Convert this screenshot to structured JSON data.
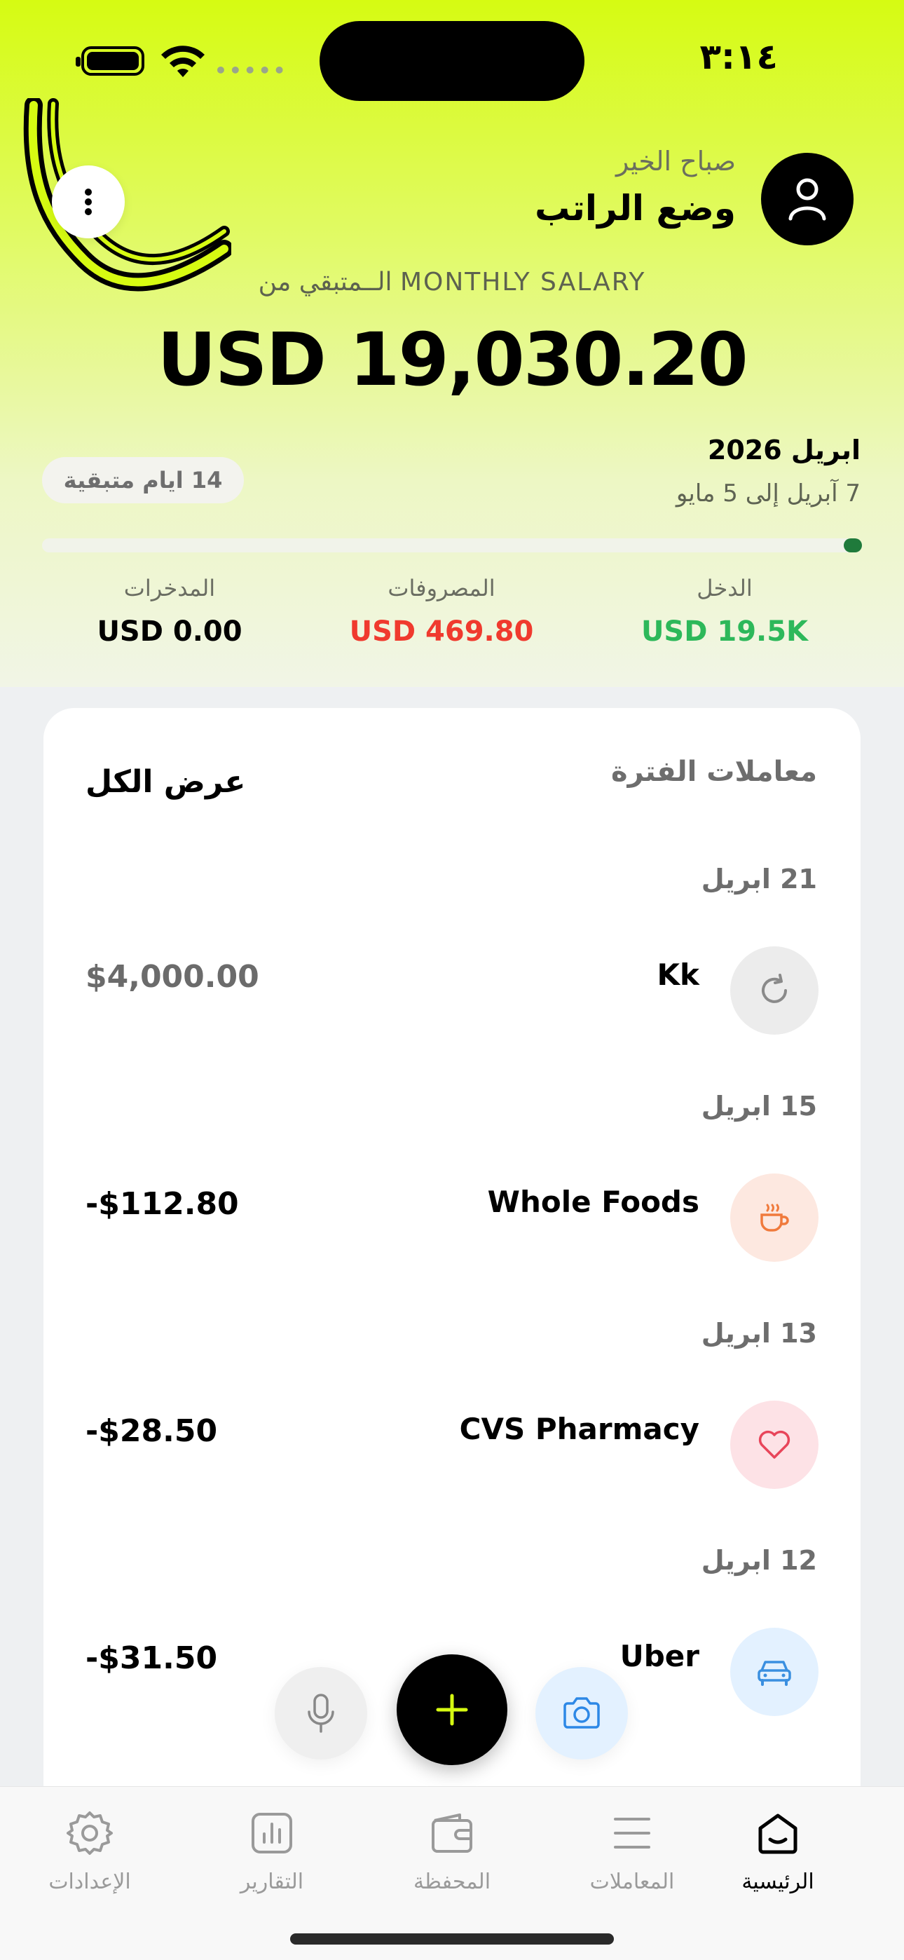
{
  "status_bar": {
    "time": "٣:١٤",
    "signal_dots": "•••••"
  },
  "header": {
    "greeting": "صباح الخير",
    "mode_title": "وضع الراتب",
    "remaining_label": "الــمتبقي من MONTHLY SALARY",
    "balance": "USD 19,030.20"
  },
  "period": {
    "month": "ابريل 2026",
    "range": "7 آبريل إلى 5 مايو",
    "days_left": "14 ايام متبقية",
    "progress_fraction": 0.01
  },
  "stats": {
    "income": {
      "label": "الدخل",
      "value": "USD 19.5K",
      "color": "#2db85a"
    },
    "expenses": {
      "label": "المصروفات",
      "value": "USD 469.80",
      "color": "#f03a2e"
    },
    "savings": {
      "label": "المدخرات",
      "value": "USD 0.00",
      "color": "#000000"
    }
  },
  "transactions_card": {
    "title": "معاملات الفترة",
    "view_all": "عرض الكل",
    "groups": [
      {
        "date": "21 ابريل",
        "name": "Kk",
        "amount": "$4,000.00",
        "icon": "refresh-icon",
        "amount_color": "#6b6b6b"
      },
      {
        "date": "15 ابريل",
        "name": "Whole Foods",
        "amount": "-$112.80",
        "icon": "coffee-cup-icon",
        "amount_color": "#000000"
      },
      {
        "date": "13 ابريل",
        "name": "CVS Pharmacy",
        "amount": "-$28.50",
        "icon": "heart-icon",
        "amount_color": "#000000"
      },
      {
        "date": "12 ابريل",
        "name": "Uber",
        "amount": "-$31.50",
        "icon": "car-icon",
        "amount_color": "#000000"
      }
    ]
  },
  "tabbar": {
    "home": "الرئيسية",
    "transactions": "المعاملات",
    "wallet": "المحفظة",
    "reports": "التقارير",
    "settings": "الإعدادات"
  },
  "colors": {
    "accent": "#d6fb12",
    "fab_add_plus": "#d6fb12"
  }
}
